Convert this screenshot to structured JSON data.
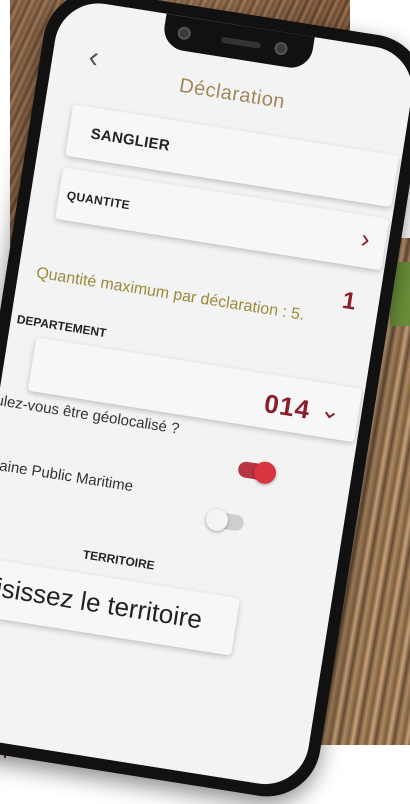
{
  "header": {
    "title": "Déclaration"
  },
  "species": {
    "label": "SANGLIER"
  },
  "quantity": {
    "label": "QUANTITE",
    "value": "1",
    "hint": "Quantité maximum par déclaration : 5."
  },
  "department": {
    "label": "DEPARTEMENT",
    "value": "014"
  },
  "geolocation": {
    "question": "Voulez-vous être géolocalisé ?",
    "enabled": true
  },
  "maritime": {
    "label": "Domaine Public Maritime",
    "enabled": false
  },
  "territory": {
    "label": "TERRITOIRE",
    "placeholder": "Choisissez le territoire"
  },
  "icons": {
    "back": "chevron-left-icon",
    "species_nav": "chevron-right-icon",
    "department_dropdown": "chevron-down-icon"
  },
  "colors": {
    "accent": "#8b1e2b",
    "title": "#a0875a",
    "hint": "#9b8a3b",
    "toggle_on": "#d9353f"
  }
}
